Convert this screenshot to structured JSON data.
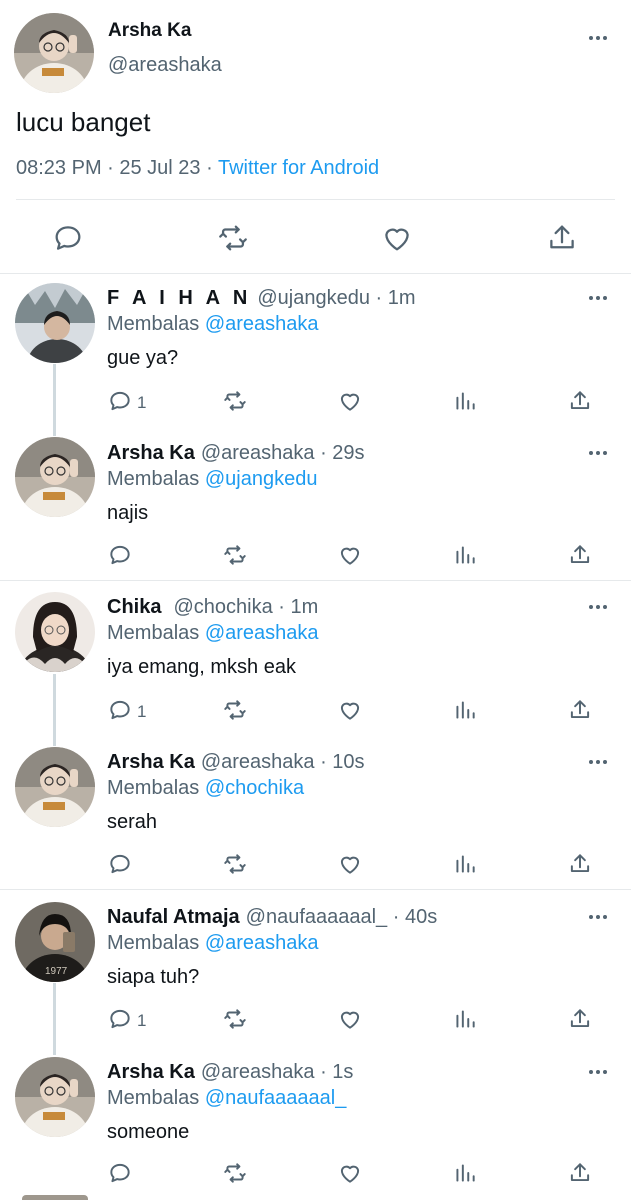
{
  "main_tweet": {
    "name": "Arsha Ka",
    "handle": "@areashaka",
    "text": "lucu banget",
    "time_date": "08:23 PM · 25 Jul 23 · ",
    "source": "Twitter for Android",
    "icons": [
      "reply-icon",
      "retweet-icon",
      "like-icon",
      "share-icon"
    ]
  },
  "replies": [
    {
      "name": "F A I H A N",
      "meta": "@ujangkedu · 1m",
      "replying_label": "Membalas",
      "replying_to": "@areashaka",
      "text": "gue ya?",
      "reply_count": "1"
    },
    {
      "name": "Arsha Ka",
      "meta": "@areashaka · 29s",
      "replying_label": "Membalas",
      "replying_to": "@ujangkedu",
      "text": "najis",
      "reply_count": ""
    },
    {
      "name": "Chika",
      "meta": "@chochika · 1m",
      "replying_label": "Membalas",
      "replying_to": "@areashaka",
      "text": "iya emang, mksh eak",
      "reply_count": "1"
    },
    {
      "name": "Arsha Ka",
      "meta": "@areashaka · 10s",
      "replying_label": "Membalas",
      "replying_to": "@chochika",
      "text": "serah",
      "reply_count": ""
    },
    {
      "name": "Naufal Atmaja",
      "meta": "@naufaaaaaal_ · 40s",
      "replying_label": "Membalas",
      "replying_to": "@areashaka",
      "text": "siapa tuh?",
      "reply_count": "1"
    },
    {
      "name": "Arsha Ka",
      "meta": "@areashaka · 1s",
      "replying_label": "Membalas",
      "replying_to": "@naufaaaaaal_",
      "text": "someone",
      "reply_count": ""
    }
  ],
  "colors": {
    "link": "#1d9bf0",
    "secondary_text": "#536471",
    "primary_text": "#0f1419",
    "divider": "#e6e9eb",
    "thread_line": "#cfd9de"
  }
}
